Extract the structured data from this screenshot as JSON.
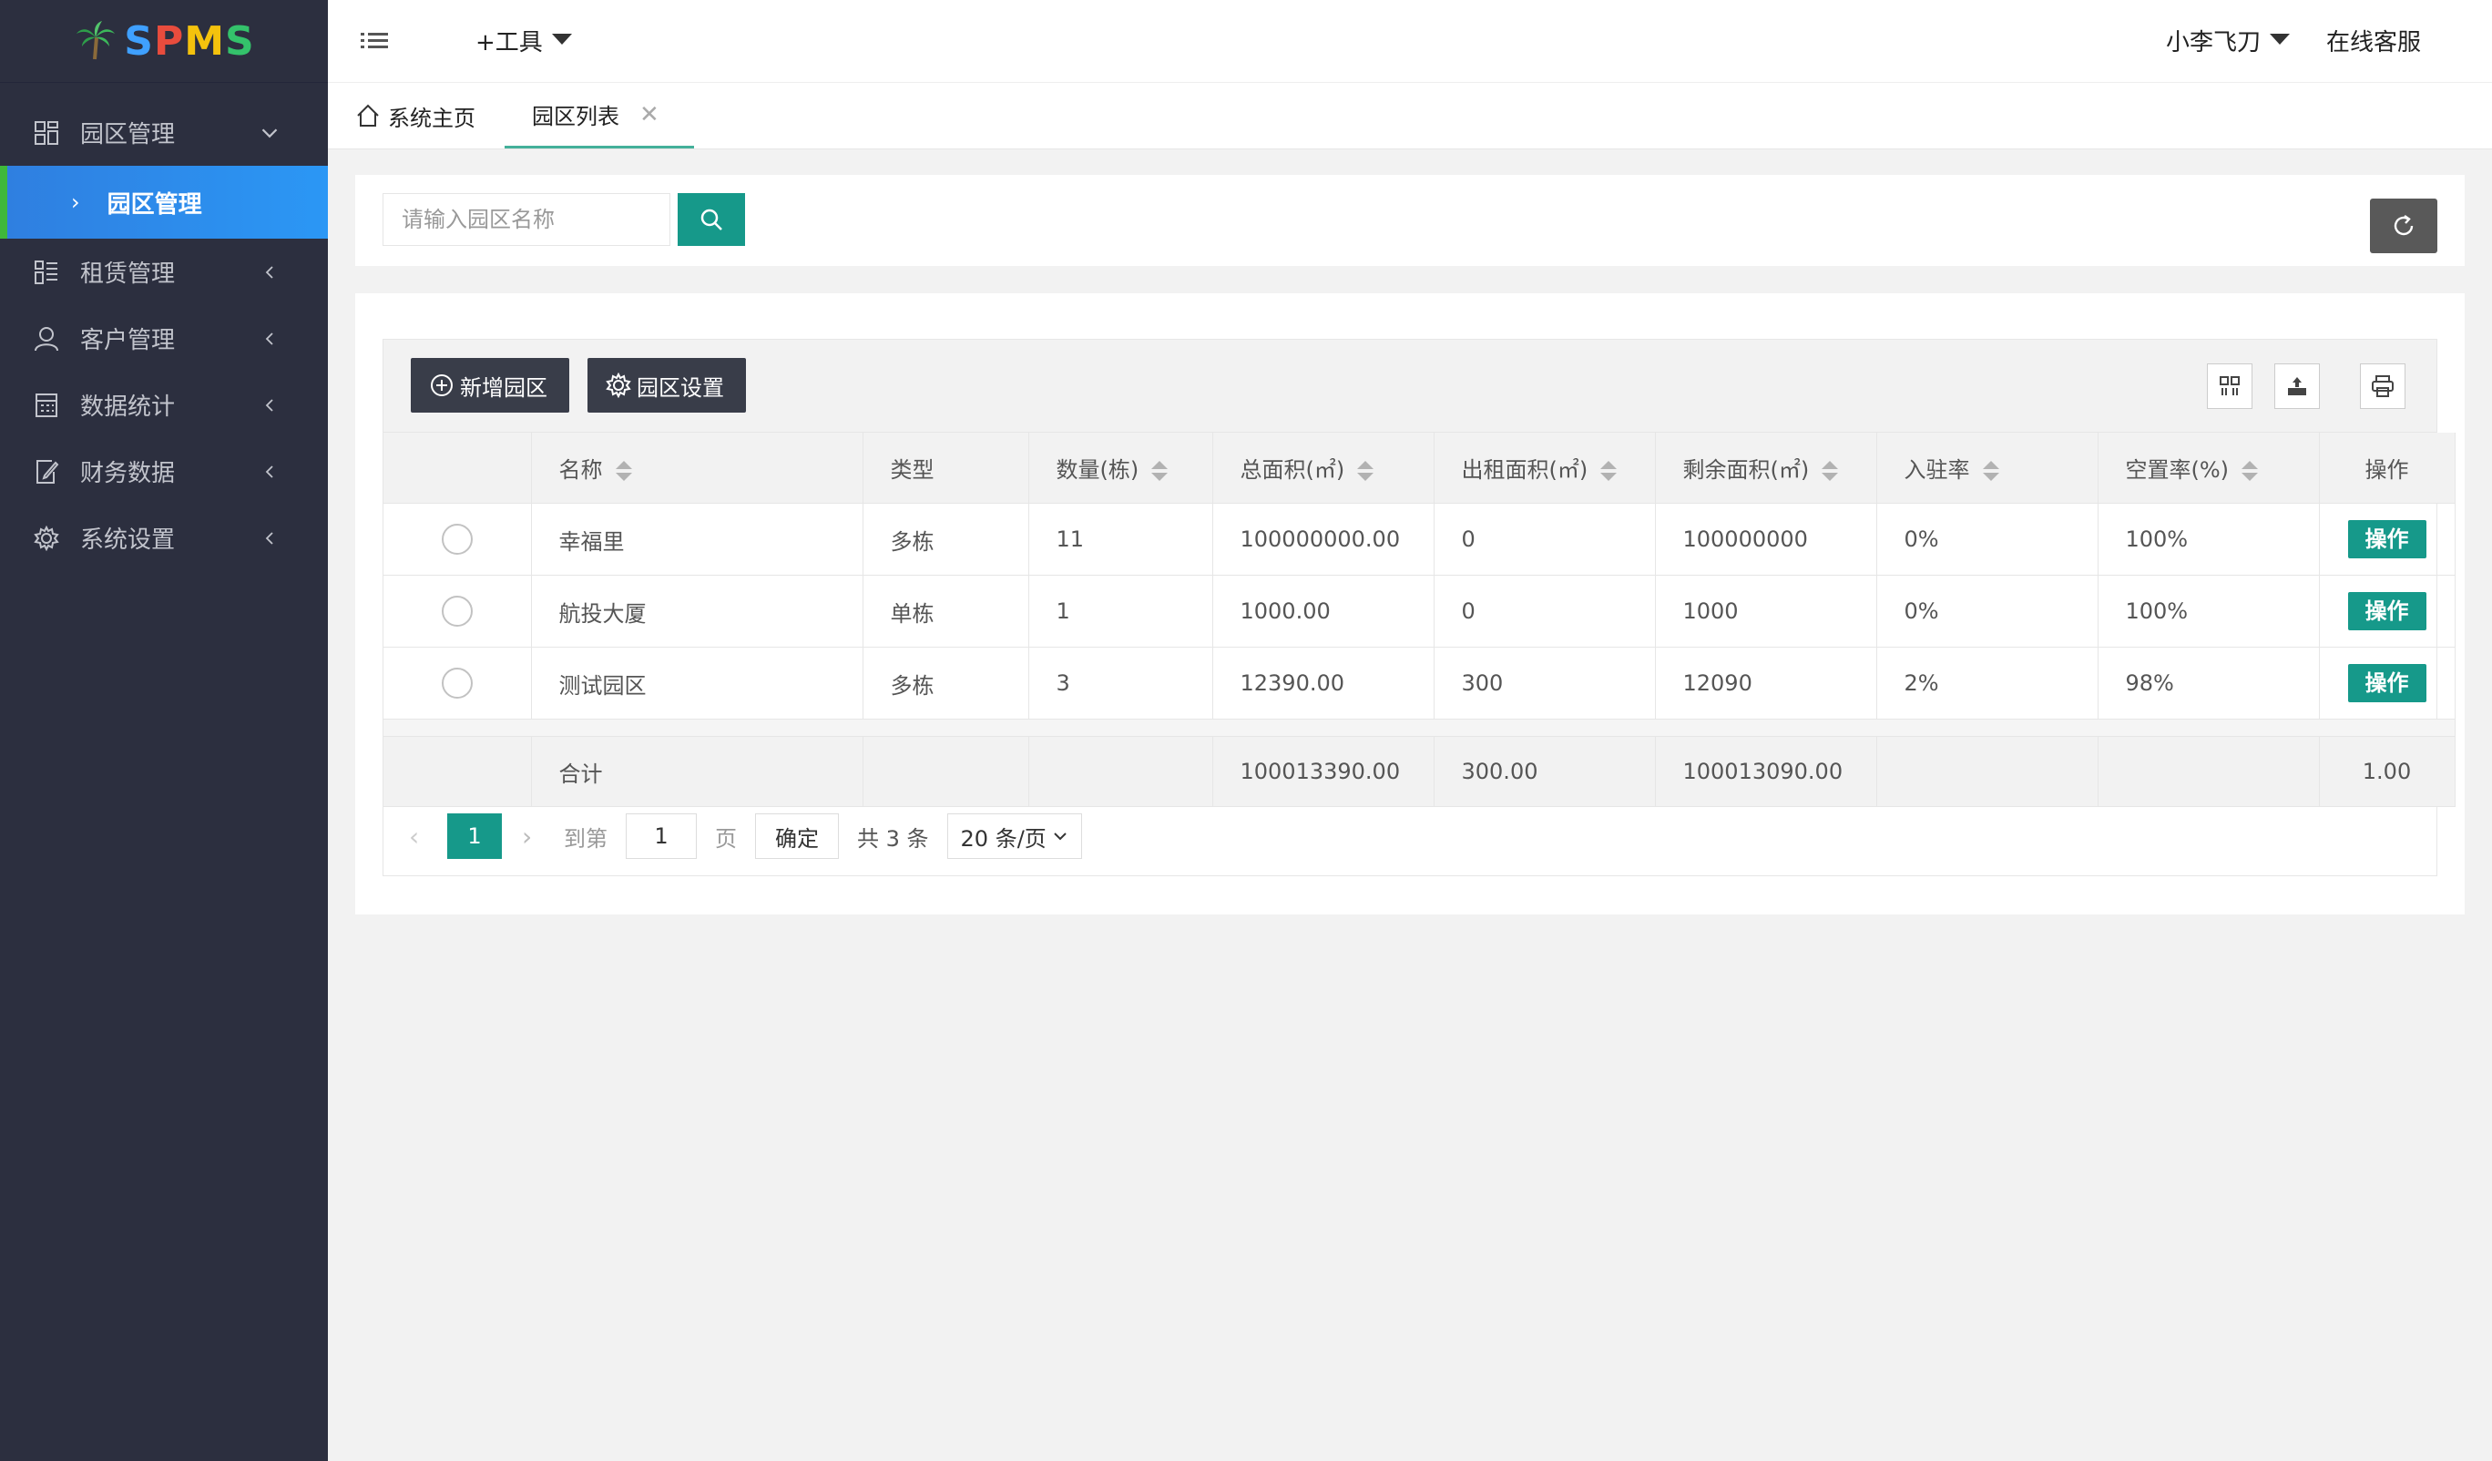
{
  "logo": {
    "text_s1": "S",
    "text_p": "P",
    "text_m": "M",
    "text_s2": "S"
  },
  "sidebar": {
    "items": [
      {
        "label": "园区管理",
        "icon": "grid-icon",
        "expanded": true
      },
      {
        "label": "租赁管理",
        "icon": "list-icon"
      },
      {
        "label": "客户管理",
        "icon": "user-icon"
      },
      {
        "label": "数据统计",
        "icon": "calculator-icon"
      },
      {
        "label": "财务数据",
        "icon": "edit-document-icon"
      },
      {
        "label": "系统设置",
        "icon": "gear-icon"
      }
    ],
    "active_sub": "园区管理"
  },
  "header": {
    "tools_label": "+工具",
    "user_label": "小李飞刀",
    "service_label": "在线客服"
  },
  "tabs": {
    "home_label": "系统主页",
    "active_label": "园区列表"
  },
  "search": {
    "placeholder": "请输入园区名称"
  },
  "toolbar": {
    "add_label": "新增园区",
    "settings_label": "园区设置"
  },
  "table": {
    "columns": [
      "名称",
      "类型",
      "数量(栋)",
      "总面积(㎡)",
      "出租面积(㎡)",
      "剩余面积(㎡)",
      "入驻率",
      "空置率(%)",
      "操作"
    ],
    "rows": [
      {
        "name": "幸福里",
        "type": "多栋",
        "count": "11",
        "total_area": "100000000.00",
        "rented_area": "0",
        "remaining_area": "100000000",
        "occupancy": "0%",
        "vacancy": "100%",
        "action": "操作"
      },
      {
        "name": "航投大厦",
        "type": "单栋",
        "count": "1",
        "total_area": "1000.00",
        "rented_area": "0",
        "remaining_area": "1000",
        "occupancy": "0%",
        "vacancy": "100%",
        "action": "操作"
      },
      {
        "name": "测试园区",
        "type": "多栋",
        "count": "3",
        "total_area": "12390.00",
        "rented_area": "300",
        "remaining_area": "12090",
        "occupancy": "2%",
        "vacancy": "98%",
        "action": "操作"
      }
    ],
    "totals": {
      "label": "合计",
      "total_area": "100013390.00",
      "rented_area": "300.00",
      "remaining_area": "100013090.00",
      "vacancy": "1.00"
    }
  },
  "pagination": {
    "current_page": "1",
    "goto_label": "到第",
    "goto_value": "1",
    "page_label": "页",
    "confirm_label": "确定",
    "total_label": "共 3 条",
    "page_size": "20 条/页"
  },
  "colors": {
    "sidebar_bg": "#2c2f3f",
    "accent_teal": "#16998a",
    "active_blue": "#2b97f5",
    "dark_button": "#393d49"
  }
}
